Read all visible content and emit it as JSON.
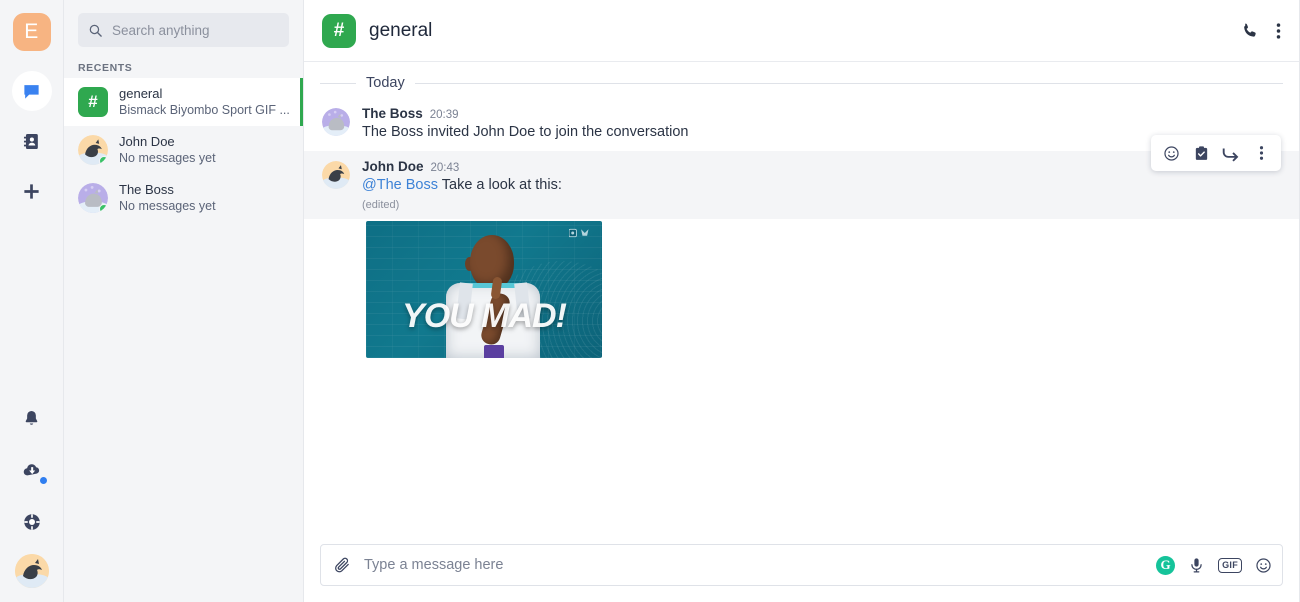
{
  "app": {
    "logo_letter": "E",
    "accent_green": "#2fa84f",
    "accent_blue": "#3d82d6",
    "sidebar_bg": "#f4f5f7"
  },
  "rail": {
    "items": [
      {
        "name": "chat-icon",
        "label": "Chat",
        "active": true
      },
      {
        "name": "contacts-icon",
        "label": "Contacts",
        "active": false
      },
      {
        "name": "add-icon",
        "label": "Add",
        "active": false
      }
    ],
    "bottom_items": [
      {
        "name": "bell-icon",
        "label": "Notifications",
        "badge": false
      },
      {
        "name": "cloud-download-icon",
        "label": "Downloads",
        "badge": true
      },
      {
        "name": "lifebuoy-icon",
        "label": "Help",
        "badge": false
      },
      {
        "name": "avatar",
        "label": "Profile",
        "badge": false
      }
    ]
  },
  "search": {
    "placeholder": "Search anything",
    "value": "",
    "icon": "search-icon"
  },
  "sidebar": {
    "section_label": "RECENTS",
    "conversations": [
      {
        "name": "general",
        "preview": "Bismack Biyombo Sport GIF ...",
        "type": "channel",
        "selected": true,
        "online": false
      },
      {
        "name": "John Doe",
        "preview": "No messages yet",
        "type": "dm",
        "selected": false,
        "online": true
      },
      {
        "name": "The Boss",
        "preview": "No messages yet",
        "type": "dm",
        "selected": false,
        "online": true
      }
    ]
  },
  "header": {
    "channel_glyph": "#",
    "title": "general",
    "actions": [
      {
        "name": "call-icon",
        "label": "Call"
      },
      {
        "name": "more-options-icon",
        "label": "More options"
      }
    ]
  },
  "messages": {
    "day_divider": "Today",
    "items": [
      {
        "author": "The Boss",
        "time": "20:39",
        "text": "The Boss invited John Doe to join the conversation",
        "mention": "",
        "edited": "",
        "hovered": false,
        "avatar_type": "boss"
      },
      {
        "author": "John Doe",
        "time": "20:43",
        "text": " Take a look at this:",
        "mention": "@The Boss",
        "edited": "(edited)",
        "hovered": true,
        "avatar_type": "john"
      }
    ],
    "hover_toolbar": [
      {
        "name": "emoji-reaction-icon",
        "label": "Add reaction"
      },
      {
        "name": "task-icon",
        "label": "Create task"
      },
      {
        "name": "reply-icon",
        "label": "Reply"
      },
      {
        "name": "message-more-icon",
        "label": "More"
      }
    ],
    "attachment": {
      "type": "gif",
      "caption": "YOU MAD!",
      "alt": "Bismack Biyombo Sport GIF"
    }
  },
  "composer": {
    "attach_icon": "paperclip-icon",
    "placeholder": "Type a message here",
    "value": "",
    "right_icons": [
      {
        "name": "grammarly-icon",
        "label": "G"
      },
      {
        "name": "microphone-icon",
        "label": "Voice message"
      },
      {
        "name": "gif-icon",
        "label": "GIF"
      },
      {
        "name": "emoji-icon",
        "label": "Emoji"
      }
    ]
  }
}
